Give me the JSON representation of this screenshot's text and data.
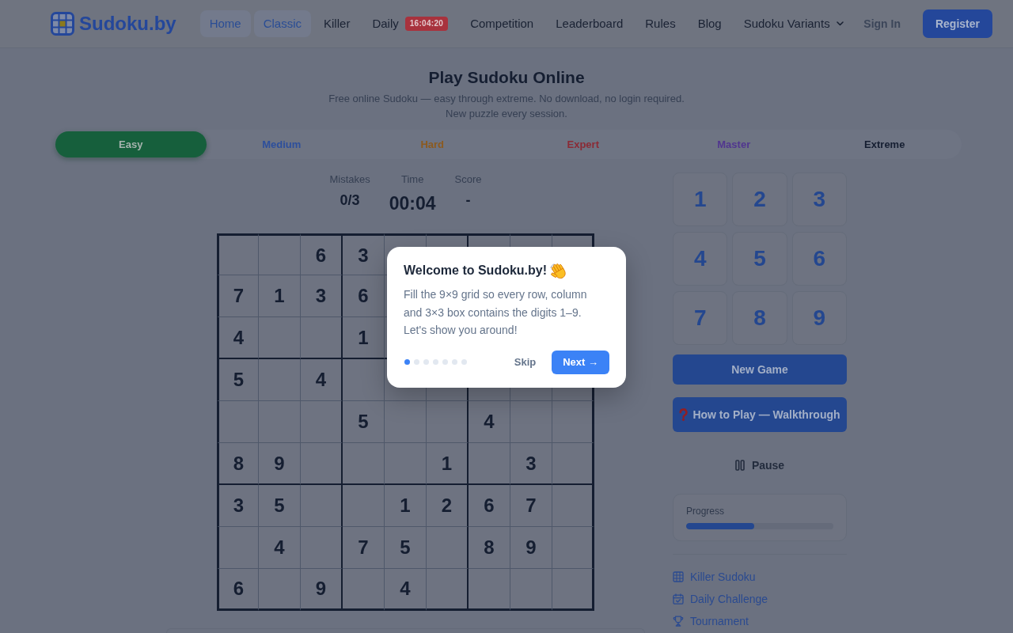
{
  "header": {
    "logo": "Sudoku.by",
    "nav": [
      {
        "label": "Home",
        "selected": true,
        "kind": "link"
      },
      {
        "label": "Classic",
        "selected": true,
        "kind": "link"
      },
      {
        "label": "Killer",
        "selected": false,
        "kind": "link"
      },
      {
        "label": "Daily",
        "selected": false,
        "kind": "link",
        "badge": "16:04:20"
      },
      {
        "label": "Competition",
        "selected": false,
        "kind": "link"
      },
      {
        "label": "Leaderboard",
        "selected": false,
        "kind": "link"
      },
      {
        "label": "Rules",
        "selected": false,
        "kind": "link"
      },
      {
        "label": "Blog",
        "selected": false,
        "kind": "link"
      },
      {
        "label": "Sudoku Variants",
        "selected": false,
        "kind": "dropdown"
      }
    ],
    "sign_in": "Sign In",
    "register": "Register"
  },
  "intro": {
    "title": "Play Sudoku Online",
    "subtitle_lines": [
      "Free online Sudoku — easy through extreme. No download, no login required.",
      "New puzzle every session."
    ]
  },
  "difficulty": [
    {
      "label": "Easy",
      "selected": true,
      "color": "#165f3c"
    },
    {
      "label": "Medium",
      "selected": false,
      "color": "#2d4f9c"
    },
    {
      "label": "Hard",
      "selected": false,
      "color": "#8c5a1e"
    },
    {
      "label": "Expert",
      "selected": false,
      "color": "#8b2a35"
    },
    {
      "label": "Master",
      "selected": false,
      "color": "#51368f"
    },
    {
      "label": "Extreme",
      "selected": false,
      "color": "#151e31"
    }
  ],
  "stats": [
    {
      "label": "Mistakes",
      "value": "0/3",
      "kind": "count"
    },
    {
      "label": "Time",
      "value": "00:04",
      "kind": "timer"
    },
    {
      "label": "Score",
      "value": "-",
      "kind": "count"
    }
  ],
  "grid": {
    "rows": [
      [
        null,
        null,
        "6",
        "3",
        null,
        null,
        null,
        null,
        null
      ],
      [
        "7",
        "1",
        "3",
        "6",
        null,
        null,
        null,
        null,
        null
      ],
      [
        "4",
        null,
        null,
        "1",
        null,
        null,
        null,
        null,
        null
      ],
      [
        "5",
        null,
        "4",
        null,
        null,
        null,
        null,
        null,
        null
      ],
      [
        null,
        null,
        null,
        "5",
        null,
        null,
        "4",
        null,
        null
      ],
      [
        "8",
        "9",
        null,
        null,
        null,
        "1",
        null,
        "3",
        null
      ],
      [
        "3",
        "5",
        null,
        null,
        "1",
        "2",
        "6",
        "7",
        null
      ],
      [
        null,
        "4",
        null,
        "7",
        "5",
        null,
        "8",
        "9",
        null
      ],
      [
        "6",
        null,
        "9",
        null,
        "4",
        null,
        null,
        null,
        null
      ]
    ]
  },
  "number_pad": [
    "1",
    "2",
    "3",
    "4",
    "5",
    "6",
    "7",
    "8",
    "9"
  ],
  "actions": {
    "new_game": "New Game",
    "how_to_play": "How to Play — Walkthrough",
    "pause": "Pause"
  },
  "progress": {
    "label": "Progress",
    "level": 0.46
  },
  "links": [
    {
      "label": "Killer Sudoku"
    },
    {
      "label": "Daily Challenge"
    },
    {
      "label": "Tournament"
    }
  ],
  "tour": {
    "title": "Welcome to Sudoku.by!",
    "text": "Fill the 9×9 grid so every row, column and 3×3 box contains the digits 1–9. Let's show you around!",
    "steps": [
      {
        "selected": true
      },
      {
        "selected": false
      },
      {
        "selected": false
      },
      {
        "selected": false
      },
      {
        "selected": false
      },
      {
        "selected": false
      },
      {
        "selected": false
      }
    ],
    "skip": "Skip",
    "next": "Next →"
  }
}
